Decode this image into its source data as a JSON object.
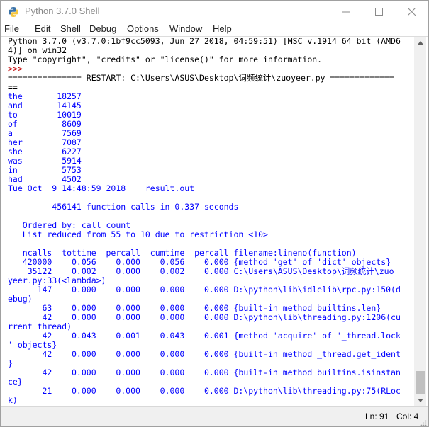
{
  "window": {
    "title": "Python 3.7.0 Shell",
    "menu": [
      "File",
      "Edit",
      "Shell",
      "Debug",
      "Options",
      "Window",
      "Help"
    ]
  },
  "shell_lines": [
    {
      "text": "Python 3.7.0 (v3.7.0:1bf9cc5093, Jun 27 2018, 04:59:51) [MSC v.1914 64 bit (AMD6",
      "style": "normal"
    },
    {
      "text": "4)] on win32",
      "style": "normal"
    },
    {
      "text": "Type \"copyright\", \"credits\" or \"license()\" for more information.",
      "style": "normal"
    },
    {
      "text": ">>> ",
      "style": "red"
    },
    {
      "text": "=============== RESTART: C:\\Users\\ASUS\\Desktop\\词频统计\\zuoyeer.py =============",
      "style": "normal"
    },
    {
      "text": "==",
      "style": "normal"
    },
    {
      "text": "the       18257",
      "style": "blue"
    },
    {
      "text": "and       14145",
      "style": "blue"
    },
    {
      "text": "to        10019",
      "style": "blue"
    },
    {
      "text": "of         8609",
      "style": "blue"
    },
    {
      "text": "a          7569",
      "style": "blue"
    },
    {
      "text": "her        7087",
      "style": "blue"
    },
    {
      "text": "she        6227",
      "style": "blue"
    },
    {
      "text": "was        5914",
      "style": "blue"
    },
    {
      "text": "in         5753",
      "style": "blue"
    },
    {
      "text": "had        4502",
      "style": "blue"
    },
    {
      "text": "Tue Oct  9 14:48:59 2018    result.out",
      "style": "blue"
    },
    {
      "text": "",
      "style": "blue"
    },
    {
      "text": "         456141 function calls in 0.337 seconds",
      "style": "blue"
    },
    {
      "text": "",
      "style": "blue"
    },
    {
      "text": "   Ordered by: call count",
      "style": "blue"
    },
    {
      "text": "   List reduced from 55 to 10 due to restriction <10>",
      "style": "blue"
    },
    {
      "text": "",
      "style": "blue"
    },
    {
      "text": "   ncalls  tottime  percall  cumtime  percall filename:lineno(function)",
      "style": "blue"
    },
    {
      "text": "   420000    0.056    0.000    0.056    0.000 {method 'get' of 'dict' objects}",
      "style": "blue"
    },
    {
      "text": "    35122    0.002    0.000    0.002    0.000 C:\\Users\\ASUS\\Desktop\\词频统计\\zuo",
      "style": "blue"
    },
    {
      "text": "yeer.py:33(<lambda>)",
      "style": "blue"
    },
    {
      "text": "      147    0.000    0.000    0.000    0.000 D:\\python\\lib\\idlelib\\rpc.py:150(d",
      "style": "blue"
    },
    {
      "text": "ebug)",
      "style": "blue"
    },
    {
      "text": "       63    0.000    0.000    0.000    0.000 {built-in method builtins.len}",
      "style": "blue"
    },
    {
      "text": "       42    0.000    0.000    0.000    0.000 D:\\python\\lib\\threading.py:1206(cu",
      "style": "blue"
    },
    {
      "text": "rrent_thread)",
      "style": "blue"
    },
    {
      "text": "       42    0.043    0.001    0.043    0.001 {method 'acquire' of '_thread.lock",
      "style": "blue"
    },
    {
      "text": "' objects}",
      "style": "blue"
    },
    {
      "text": "       42    0.000    0.000    0.000    0.000 {built-in method _thread.get_ident",
      "style": "blue"
    },
    {
      "text": "}",
      "style": "blue"
    },
    {
      "text": "       42    0.000    0.000    0.000    0.000 {built-in method builtins.isinstan",
      "style": "blue"
    },
    {
      "text": "ce}",
      "style": "blue"
    },
    {
      "text": "       21    0.000    0.000    0.000    0.000 D:\\python\\lib\\threading.py:75(RLoc",
      "style": "blue"
    },
    {
      "text": "k)",
      "style": "blue"
    }
  ],
  "status": {
    "line": "Ln: 91",
    "col": "Col: 4"
  },
  "colors": {
    "output": "#0000ff",
    "prompt": "#c00000",
    "title_text": "#8a8a8a"
  },
  "icons": {
    "app": "python-icon",
    "minimize": "minimize-icon",
    "maximize": "maximize-icon",
    "close": "close-icon"
  }
}
